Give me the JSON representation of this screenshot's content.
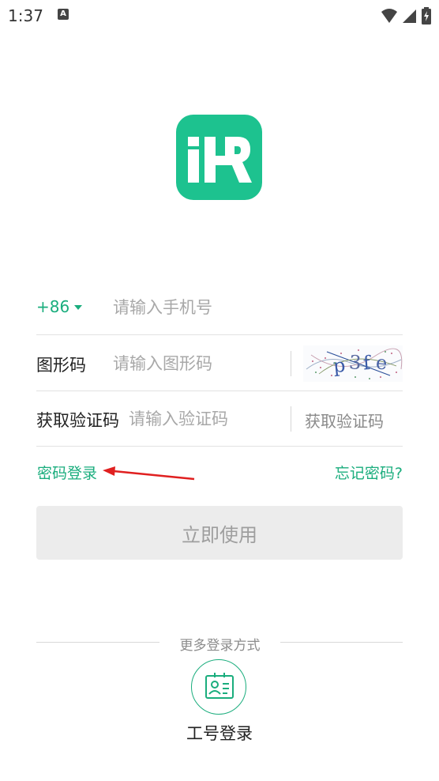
{
  "status_bar": {
    "time": "1:37",
    "notif_glyph": "A"
  },
  "form": {
    "country_code": "+86",
    "phone_placeholder": "请输入手机号",
    "captcha_label": "图形码",
    "captcha_placeholder": "请输入图形码",
    "sms_label": "获取验证码",
    "sms_placeholder": "请输入验证码",
    "get_code_label": "获取验证码"
  },
  "links": {
    "password_login": "密码登录",
    "forgot_password": "忘记密码?"
  },
  "submit_label": "立即使用",
  "more_login": {
    "divider_text": "更多登录方式",
    "employee_login_label": "工号登录"
  },
  "colors": {
    "accent": "#1aad7d",
    "logo_bg": "#1dc28f",
    "annotation": "#e02020"
  },
  "icons": [
    "wifi-icon",
    "signal-icon",
    "battery-icon",
    "chevron-down-icon",
    "employee-id-card-icon"
  ]
}
